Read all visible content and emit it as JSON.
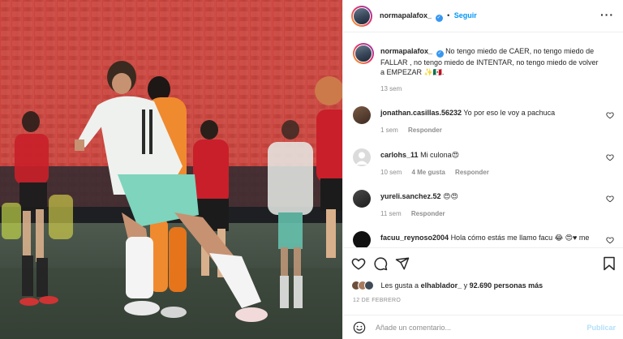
{
  "post": {
    "author": "normapalafox_",
    "follow_label": "Seguir",
    "caption": "No tengo miedo de CAER, no tengo miedo de FALLAR , no tengo miedo de INTENTAR, no tengo miedo de volver a EMPEZAR ✨🇲🇽.",
    "caption_time": "13 sem",
    "likes_prefix": "Les gusta a ",
    "likes_user": "elhablador_",
    "likes_mid": " y ",
    "likes_count": "92.690 personas más",
    "date": "12 DE FEBRERO",
    "comment_placeholder": "Añade un comentario...",
    "publish_label": "Publicar"
  },
  "comments": [
    {
      "user": "jonathan.casillas.56232",
      "text": "Yo por eso le voy a pachuca",
      "time": "1 sem",
      "likes": "",
      "reply": "Responder"
    },
    {
      "user": "carlohs_11",
      "text": "Mi culona😍",
      "time": "10 sem",
      "likes": "4 Me gusta",
      "reply": "Responder"
    },
    {
      "user": "yureli.sanchez.52",
      "text": "😍😍",
      "time": "11 sem",
      "likes": "",
      "reply": "Responder"
    },
    {
      "user": "facuu_reynoso2004",
      "text": "Hola cómo estás me llamo facu 😂 😍♥ me",
      "time": "",
      "likes": "",
      "reply": ""
    }
  ],
  "icons": {
    "verified": "verified-badge-icon",
    "more": "more-options-icon",
    "like": "heart-icon",
    "comment": "comment-bubble-icon",
    "share": "paper-plane-icon",
    "save": "bookmark-icon",
    "emoji": "emoji-icon"
  },
  "colors": {
    "accent": "#0095f6",
    "verified": "#3897f0",
    "muted": "#8e8e8e",
    "publish_disabled": "#b2dffc"
  }
}
